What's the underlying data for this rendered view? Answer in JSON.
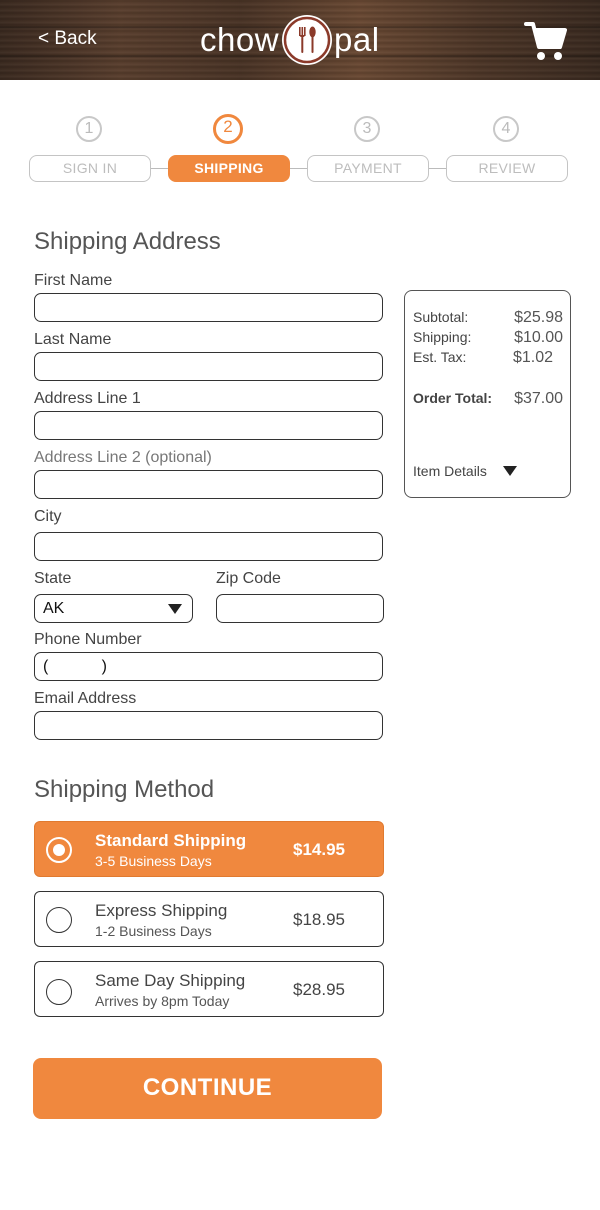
{
  "header": {
    "back_label": "< Back",
    "logo_left": "chow",
    "logo_right": "pal",
    "cart_icon": "cart-icon"
  },
  "steps": [
    {
      "number": "1",
      "label": "SIGN IN",
      "active": false
    },
    {
      "number": "2",
      "label": "SHIPPING",
      "active": true
    },
    {
      "number": "3",
      "label": "PAYMENT",
      "active": false
    },
    {
      "number": "4",
      "label": "REVIEW",
      "active": false
    }
  ],
  "shipping_address": {
    "title": "Shipping Address",
    "first_name_label": "First Name",
    "first_name_value": "",
    "last_name_label": "Last Name",
    "last_name_value": "",
    "address1_label": "Address Line 1",
    "address1_value": "",
    "address2_label": "Address Line 2 (optional)",
    "address2_value": "",
    "city_label": "City",
    "city_value": "",
    "state_label": "State",
    "state_value": "AK",
    "zip_label": "Zip Code",
    "zip_value": "",
    "phone_label": "Phone Number",
    "phone_value": "(            )",
    "email_label": "Email Address",
    "email_value": ""
  },
  "order_summary": {
    "subtotal_label": "Subtotal:",
    "subtotal_value": "$25.98",
    "shipping_label": "Shipping:",
    "shipping_value": "$10.00",
    "tax_label": "Est. Tax:",
    "tax_value": "$1.02",
    "total_label": "Order Total:",
    "total_value": "$37.00",
    "item_details_label": "Item Details"
  },
  "shipping_method": {
    "title": "Shipping Method",
    "options": [
      {
        "name": "Standard Shipping",
        "sub": "3-5 Business Days",
        "price": "$14.95",
        "selected": true
      },
      {
        "name": "Express Shipping",
        "sub": "1-2 Business Days",
        "price": "$18.95",
        "selected": false
      },
      {
        "name": "Same Day Shipping",
        "sub": "Arrives by 8pm Today",
        "price": "$28.95",
        "selected": false
      }
    ]
  },
  "continue_label": "CONTINUE",
  "colors": {
    "accent": "#f0883e",
    "header_wood": "#4a3426",
    "text": "#444444",
    "border": "#333333"
  }
}
